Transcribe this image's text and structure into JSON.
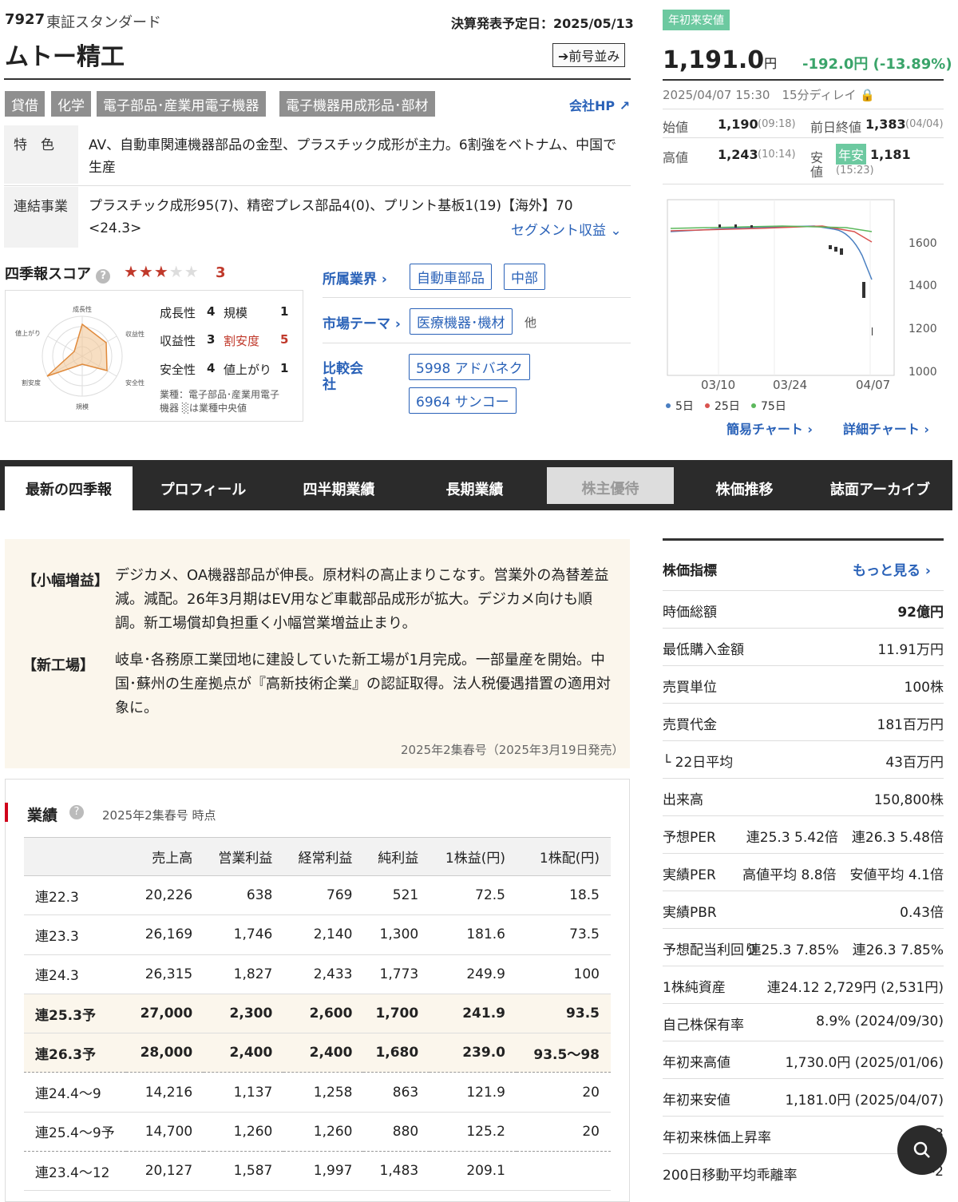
{
  "header": {
    "code": "7927",
    "market": "東証スタンダード",
    "name": "ムトー精工",
    "announce": "決算発表予定日：2025/05/13",
    "mae_button": "➔前号並み",
    "company_hp": "会社HP ↗",
    "industries": [
      "貸借",
      "化学",
      "電子部品･産業用電子機器",
      "電子機器用成形品･部材"
    ]
  },
  "feature": {
    "tokushoku_label": "特　色",
    "tokushoku": "AV、自動車関連機器部品の金型、プラスチック成形が主力。6割強をベトナム、中国で生産",
    "renketsu_label": "連結事業",
    "renketsu": "プラスチック成形95(7)、精密プレス部品4(0)、プリント基板1(19)【海外】70 <24.3>",
    "segment_link": "セグメント収益 ⌄"
  },
  "score": {
    "label": "四季報スコア",
    "stars": "★★★★★",
    "value": "3",
    "radar_labels": [
      "成長性",
      "収益性",
      "安全性",
      "規模",
      "割安度",
      "値上がり"
    ],
    "items": [
      {
        "k": "成長性",
        "v": "4"
      },
      {
        "k": "規模",
        "v": "1"
      },
      {
        "k": "収益性",
        "v": "3"
      },
      {
        "k": "割安度",
        "v": "5"
      },
      {
        "k": "安全性",
        "v": "4"
      },
      {
        "k": "値上がり",
        "v": "1"
      }
    ],
    "note1": "業種：電子部品･産業用電子",
    "note2": "機器 ░は業種中央値"
  },
  "meta": {
    "gyokai_label": "所属業界 ›",
    "gyokai_tags": [
      "自動車部品",
      "中部"
    ],
    "theme_label": "市場テーマ ›",
    "theme_tags": [
      "医療機器･機材"
    ],
    "theme_more": "他",
    "hikaku_label": "比較会",
    "hikaku_label2": "社",
    "hikaku_tags": [
      "5998 アドバネク",
      "6964 サンコー"
    ]
  },
  "price": {
    "badge": "年初来安値",
    "value": "1,191.0",
    "unit": "円",
    "change": "-192.0円 (-13.89%)",
    "time": "2025/04/07 15:30",
    "delay": "15分ディレイ 🔒",
    "open_lbl": "始値",
    "open": "1,190",
    "open_t": "(09:18)",
    "prev_lbl": "前日終値",
    "prev": "1,383",
    "prev_d": "(04/04)",
    "high_lbl": "高値",
    "high": "1,243",
    "high_t": "(10:14)",
    "low_lbl": "安",
    "low_lbl2": "値",
    "low_badge": "年安",
    "low": "1,181",
    "low_t": "(15:23)"
  },
  "chart_data": {
    "type": "line",
    "x_ticks": [
      "03/10",
      "03/24",
      "04/07"
    ],
    "y_ticks": [
      "1600",
      "1400",
      "1200",
      "1000"
    ],
    "ylim": [
      1000,
      1750
    ],
    "series": [
      {
        "name": "5日",
        "color": "#4a7fc1"
      },
      {
        "name": "25日",
        "color": "#d9534f"
      },
      {
        "name": "75日",
        "color": "#5cb85c"
      }
    ],
    "links": [
      "簡易チャート ›",
      "詳細チャート ›"
    ]
  },
  "tabs": [
    "最新の四季報",
    "プロフィール",
    "四半期業績",
    "長期業績",
    "株主優待",
    "株価推移",
    "誌面アーカイブ"
  ],
  "comment": {
    "t1": "【小幅増益】",
    "c1": "デジカメ、OA機器部品が伸長。原材料の高止まりこなす。営業外の為替差益減。減配。26年3月期はEV用など車載部品成形が拡大。デジカメ向けも順調。新工場償却負担重く小幅営業増益止まり。",
    "t2": "【新工場】",
    "c2": "岐阜･各務原工業団地に建設していた新工場が1月完成。一部量産を開始。中国･蘇州の生産拠点が『高新技術企業』の認証取得。法人税優遇措置の適用対象に。",
    "issue": "2025年2集春号（2025年3月19日発売）"
  },
  "results": {
    "label": "業績",
    "note": "2025年2集春号 時点",
    "headers": [
      "",
      "売上高",
      "営業利益",
      "経常利益",
      "純利益",
      "1株益(円)",
      "1株配(円)"
    ],
    "rows": [
      [
        "連22.3",
        "20,226",
        "638",
        "769",
        "521",
        "72.5",
        "18.5"
      ],
      [
        "連23.3",
        "26,169",
        "1,746",
        "2,140",
        "1,300",
        "181.6",
        "73.5"
      ],
      [
        "連24.3",
        "26,315",
        "1,827",
        "2,433",
        "1,773",
        "249.9",
        "100"
      ],
      [
        "連25.3予",
        "27,000",
        "2,300",
        "2,600",
        "1,700",
        "241.9",
        "93.5"
      ],
      [
        "連26.3予",
        "28,000",
        "2,400",
        "2,400",
        "1,680",
        "239.0",
        "93.5〜98"
      ],
      [
        "連24.4〜9",
        "14,216",
        "1,137",
        "1,258",
        "863",
        "121.9",
        "20"
      ],
      [
        "連25.4〜9予",
        "14,700",
        "1,260",
        "1,260",
        "880",
        "125.2",
        "20"
      ],
      [
        "連23.4〜12",
        "20,127",
        "1,587",
        "1,997",
        "1,483",
        "209.1",
        ""
      ]
    ]
  },
  "indicators": {
    "title": "株価指標",
    "more": "もっと見る ›",
    "rows": [
      {
        "k": "時価総額",
        "v": "92億円"
      },
      {
        "k": "最低購入金額",
        "v": "11.91万円"
      },
      {
        "k": "売買単位",
        "v": "100株"
      },
      {
        "k": "売買代金",
        "v": "181百万円"
      },
      {
        "k": "└ 22日平均",
        "v": "43百万円"
      },
      {
        "k": "出来高",
        "v": "150,800株"
      },
      {
        "k": "予想PER",
        "v": "連25.3 5.42倍　連26.3 5.48倍"
      },
      {
        "k": "実績PER",
        "v": "高値平均 8.8倍　安値平均 4.1倍"
      },
      {
        "k": "実績PBR",
        "v": "0.43倍"
      },
      {
        "k": "予想配当利回り",
        "v": "連25.3 7.85%　連26.3 7.85%"
      },
      {
        "k": "1株純資産",
        "v": "連24.12 2,729円 (2,531円)"
      },
      {
        "k": "自己株保有率",
        "v": "8.9% (2024/09/30)"
      },
      {
        "k": "年初来高値",
        "v": "1,730.0円 (2025/01/06)"
      },
      {
        "k": "年初来安値",
        "v": "1,181.0円 (2025/04/07)"
      },
      {
        "k": "年初来株価上昇率",
        "v": "-3"
      },
      {
        "k": "200日移動平均乖離率",
        "v": "-2"
      }
    ]
  }
}
